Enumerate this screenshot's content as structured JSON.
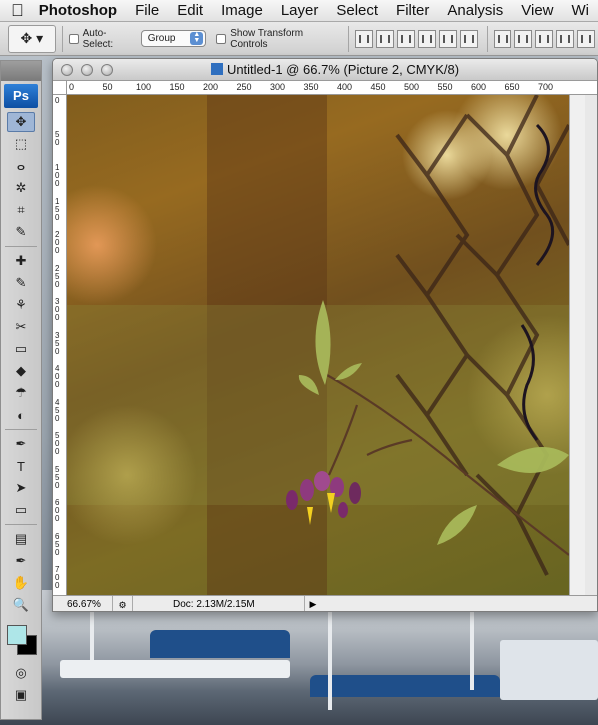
{
  "menubar": {
    "app": "Photoshop",
    "items": [
      "File",
      "Edit",
      "Image",
      "Layer",
      "Select",
      "Filter",
      "Analysis",
      "View",
      "Wi"
    ]
  },
  "options": {
    "auto_select_label": "Auto-Select:",
    "auto_select_value": "Group",
    "transform_label": "Show Transform Controls"
  },
  "tools": {
    "logo": "Ps",
    "icons": [
      "move-icon",
      "marquee-icon",
      "lasso-icon",
      "magic-wand-icon",
      "crop-icon",
      "eyedropper-icon",
      "healing-brush-icon",
      "brush-icon",
      "clone-stamp-icon",
      "history-brush-icon",
      "eraser-icon",
      "paint-bucket-icon",
      "blur-icon",
      "dodge-icon",
      "pen-icon",
      "type-icon",
      "path-selection-icon",
      "shape-icon",
      "notes-icon",
      "eyedropper-2-icon",
      "hand-icon",
      "zoom-icon"
    ],
    "glyphs": [
      "✥",
      "⬚",
      "ⴰ",
      "✲",
      "⌗",
      "✎",
      "✚",
      "✎",
      "⚘",
      "✂",
      "▭",
      "◆",
      "☂",
      "◐",
      "✒",
      "T",
      "➤",
      "▭",
      "▤",
      "✒",
      "✋",
      "🔍"
    ],
    "foreground_color": "#aee6e8",
    "background_color": "#000000"
  },
  "document": {
    "title": "Untitled-1 @ 66.7% (Picture 2, CMYK/8)",
    "ruler_top": [
      "0",
      "50",
      "100",
      "150",
      "200",
      "250",
      "300",
      "350",
      "400",
      "450",
      "500",
      "550",
      "600",
      "650",
      "700"
    ],
    "ruler_left": [
      "0",
      "50",
      "100",
      "150",
      "200",
      "250",
      "300",
      "350",
      "400",
      "450",
      "500",
      "550",
      "600",
      "650",
      "700"
    ],
    "zoom": "66.67%",
    "doc_info": "Doc: 2.13M/2.15M"
  }
}
